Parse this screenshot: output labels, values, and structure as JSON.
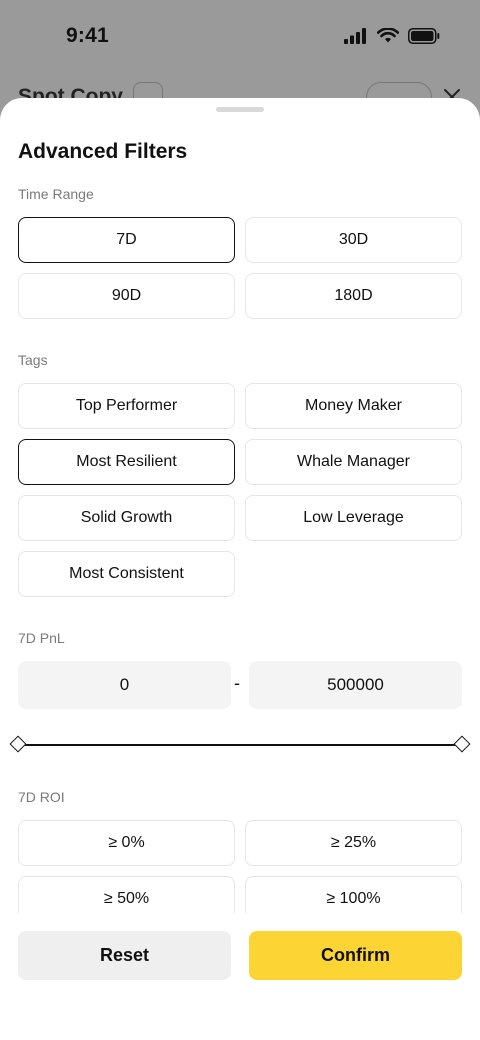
{
  "status_bar": {
    "time": "9:41"
  },
  "background_page": {
    "title": "Spot Copy"
  },
  "sheet": {
    "title": "Advanced Filters",
    "time_range": {
      "label": "Time Range",
      "options": [
        "7D",
        "30D",
        "90D",
        "180D"
      ],
      "selected": "7D"
    },
    "tags": {
      "label": "Tags",
      "options": [
        "Top Performer",
        "Money Maker",
        "Most Resilient",
        "Whale Manager",
        "Solid Growth",
        "Low Leverage",
        "Most Consistent"
      ],
      "selected": "Most Resilient"
    },
    "pnl": {
      "label": "7D PnL",
      "min_value": "0",
      "separator": "-",
      "max_value": "500000",
      "slider_low": 0,
      "slider_high": 1
    },
    "roi": {
      "label": "7D ROI",
      "options": [
        "≥ 0%",
        "≥ 25%",
        "≥ 50%",
        "≥ 100%"
      ]
    }
  },
  "footer": {
    "reset_label": "Reset",
    "confirm_label": "Confirm"
  },
  "colors": {
    "accent": "#FCD535",
    "selected_border": "#111111",
    "input_bg": "#F4F4F4"
  }
}
